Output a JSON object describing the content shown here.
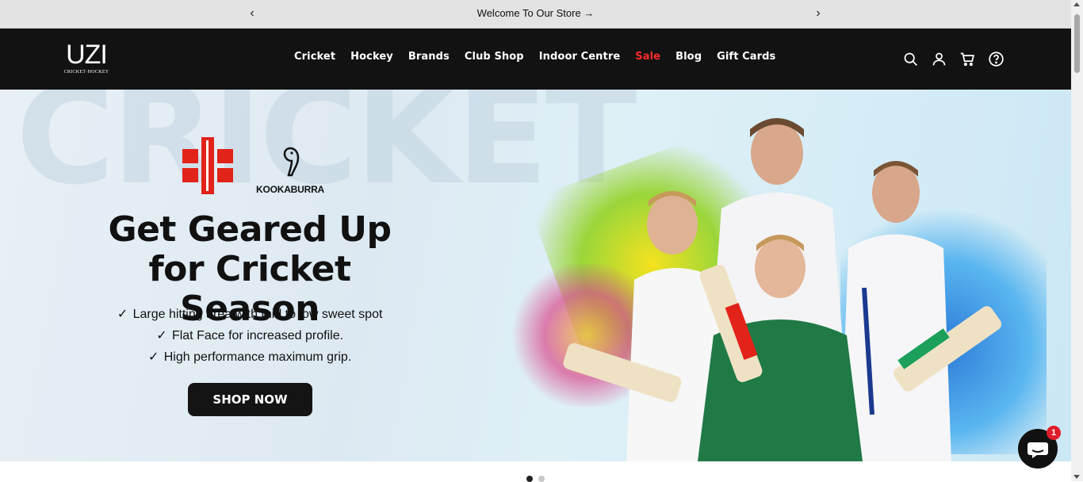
{
  "announcement": {
    "prev_label": "‹",
    "text": "Welcome To Our Store →",
    "next_label": "›"
  },
  "header": {
    "logo_mark": "UZI",
    "logo_sub": "CRICKET·HOCKEY",
    "nav": [
      "Cricket",
      "Hockey",
      "Brands",
      "Club Shop",
      "Indoor Centre",
      "Sale",
      "Blog",
      "Gift Cards"
    ],
    "icons": [
      "search-icon",
      "account-icon",
      "cart-icon",
      "help-icon"
    ],
    "sale_color": "#ff2a2a"
  },
  "hero": {
    "bg_text": "CRICKET",
    "brand1": "GRAY-NICOLLS",
    "brand2": "KOOKABURRA",
    "headline_line1": "Get Geared Up",
    "headline_line2": "for Cricket Season",
    "features": [
      "Large hitting area with mid to low sweet spot",
      "Flat Face for increased profile.",
      "High performance maximum grip."
    ],
    "cta": "SHOP NOW"
  },
  "slider": {
    "slides": 2,
    "active": 1
  },
  "chat": {
    "badge": "1"
  }
}
